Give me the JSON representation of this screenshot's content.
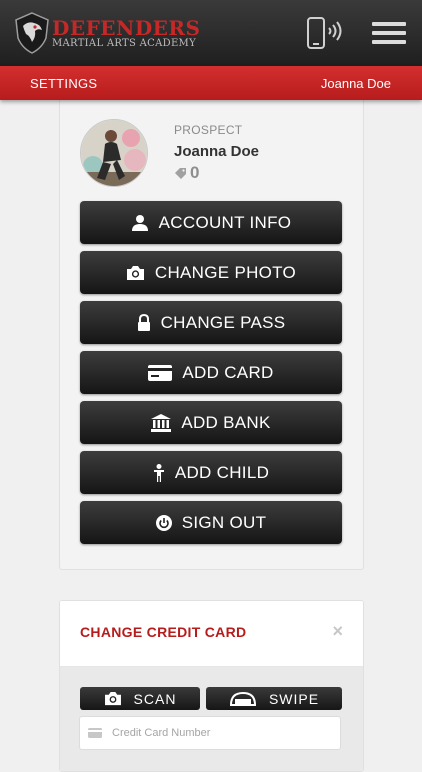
{
  "brand": {
    "title": "DEFENDERS",
    "subtitle": "MARTIAL ARTS ACADEMY"
  },
  "header": {
    "phone_icon": "phone-signal-icon",
    "menu_icon": "hamburger-menu-icon"
  },
  "subbar": {
    "left_label": "SETTINGS",
    "right_label": "Joanna Doe"
  },
  "profile": {
    "role": "PROSPECT",
    "name": "Joanna Doe",
    "points": "0"
  },
  "actions": [
    {
      "label": "ACCOUNT INFO",
      "icon": "user-icon"
    },
    {
      "label": "CHANGE PHOTO",
      "icon": "camera-icon"
    },
    {
      "label": "CHANGE PASS",
      "icon": "lock-icon"
    },
    {
      "label": "ADD CARD",
      "icon": "credit-card-icon"
    },
    {
      "label": "ADD BANK",
      "icon": "bank-icon"
    },
    {
      "label": "ADD CHILD",
      "icon": "child-icon"
    },
    {
      "label": "SIGN OUT",
      "icon": "power-icon"
    }
  ],
  "credit_card": {
    "title": "CHANGE CREDIT CARD",
    "close": "×",
    "scan_label": "SCAN",
    "swipe_label": "SWIPE",
    "number_placeholder": "Credit Card Number"
  },
  "colors": {
    "brand_red": "#c62828",
    "dark_button": "#222222",
    "header_bg": "#2b2b2b"
  }
}
